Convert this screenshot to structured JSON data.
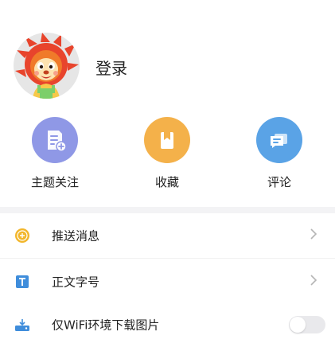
{
  "profile": {
    "login_label": "登录"
  },
  "shortcuts": [
    {
      "label": "主题关注",
      "icon": "subscribe-doc-icon",
      "color": "#8f98e6"
    },
    {
      "label": "收藏",
      "icon": "bookmark-icon",
      "color": "#f4b14a"
    },
    {
      "label": "评论",
      "icon": "comment-icon",
      "color": "#5aa3e6"
    }
  ],
  "settings": [
    {
      "label": "推送消息",
      "icon": "push-message-icon",
      "color": "#f2b62b",
      "control": "chevron"
    },
    {
      "label": "正文字号",
      "icon": "font-size-icon",
      "color": "#3f8ddb",
      "control": "chevron"
    },
    {
      "label": "仅WiFi环境下载图片",
      "icon": "wifi-download-icon",
      "color": "#3f8ddb",
      "control": "toggle",
      "toggle_on": false
    }
  ]
}
